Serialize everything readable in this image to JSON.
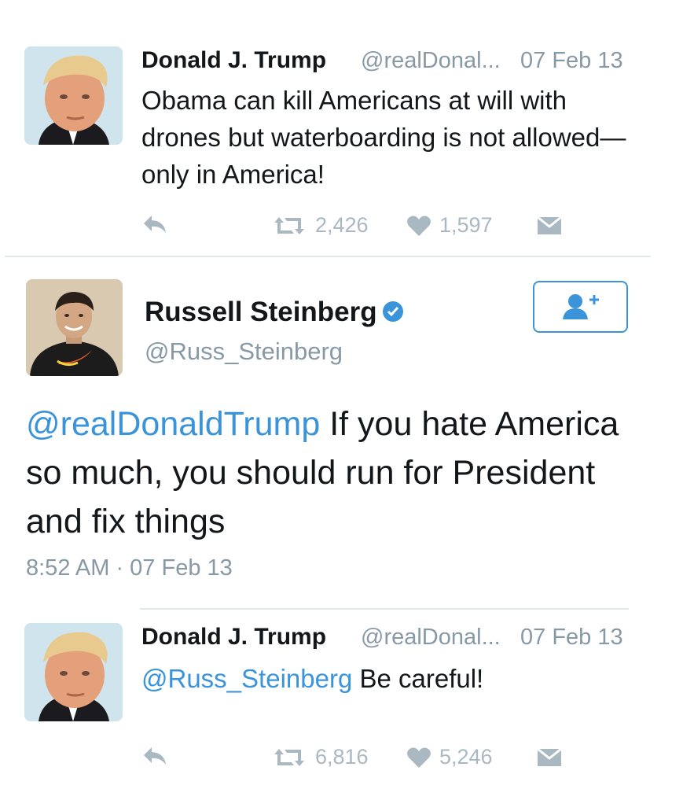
{
  "tweet1": {
    "author_name": "Donald J. Trump",
    "author_handle": "@realDonal...",
    "date": "07 Feb 13",
    "text": "Obama can kill Americans at will with drones but waterboarding is not allowed—only in America!",
    "retweets": "2,426",
    "likes": "1,597",
    "avatar_icon": "avatar-photo"
  },
  "profile": {
    "name": "Russell Steinberg",
    "handle": "@Russ_Steinberg",
    "verified_icon": "verified-badge-icon",
    "follow_icon": "follow-user-icon",
    "avatar_icon": "avatar-photo"
  },
  "main_tweet": {
    "mention": "@realDonaldTrump",
    "text": " If you hate America so much, you should run for President and fix things",
    "timestamp": "8:52 AM · 07 Feb 13"
  },
  "tweet2": {
    "author_name": "Donald J. Trump",
    "author_handle": "@realDonal...",
    "date": "07 Feb 13",
    "mention": "@Russ_Steinberg",
    "text": " Be careful!",
    "retweets": "6,816",
    "likes": "5,246"
  },
  "colors": {
    "link": "#3b94d9",
    "muted": "#8899a6",
    "icon": "#aab8c2",
    "divider": "#e1e8ed"
  },
  "icons": [
    "reply-icon",
    "retweet-icon",
    "heart-icon",
    "direct-message-icon"
  ]
}
